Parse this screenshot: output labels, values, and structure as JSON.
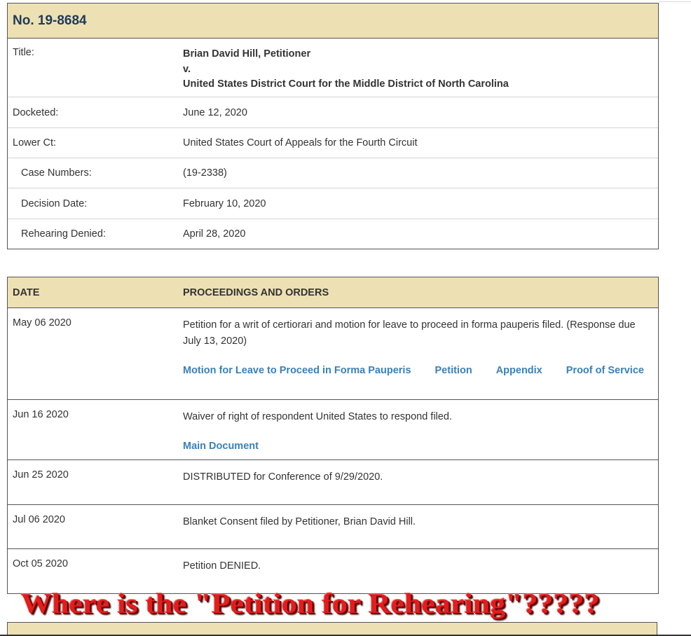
{
  "docket": {
    "number": "No. 19-8684",
    "title_label": "Title:",
    "title_lines": [
      "Brian David Hill, Petitioner",
      "v.",
      "United States District Court for the Middle District of North Carolina"
    ],
    "docketed_label": "Docketed:",
    "docketed_value": "June 12, 2020",
    "lower_ct_label": "Lower Ct:",
    "lower_ct_value": "United States Court of Appeals for the Fourth Circuit",
    "case_numbers_label": "Case Numbers:",
    "case_numbers_value": "(19-2338)",
    "decision_date_label": "Decision Date:",
    "decision_date_value": "February 10, 2020",
    "rehearing_label": "Rehearing Denied:",
    "rehearing_value": "April 28, 2020"
  },
  "proceedings": {
    "header_date": "DATE",
    "header_proceedings": "PROCEEDINGS AND ORDERS",
    "rows": [
      {
        "date": "May 06 2020",
        "text": "Petition for a writ of certiorari and motion for leave to proceed in forma pauperis filed. (Response due July 13, 2020)",
        "links": [
          "Motion for Leave to Proceed in Forma Pauperis",
          "Petition",
          "Appendix",
          "Proof of Service"
        ]
      },
      {
        "date": "Jun 16 2020",
        "text": "Waiver of right of respondent United States to respond filed.",
        "links": [
          "Main Document"
        ]
      },
      {
        "date": "Jun 25 2020",
        "text": "DISTRIBUTED for Conference of 9/29/2020."
      },
      {
        "date": "Jul 06 2020",
        "text": "Blanket Consent filed by Petitioner, Brian David Hill."
      },
      {
        "date": "Oct 05 2020",
        "text": "Petition DENIED."
      }
    ]
  },
  "annotation": {
    "text": "Where is the \"Petition for Rehearing\"?????"
  },
  "colors": {
    "header_bg": "#ede0b3",
    "link": "#3a80b8",
    "annotation": "#e31c1c"
  }
}
